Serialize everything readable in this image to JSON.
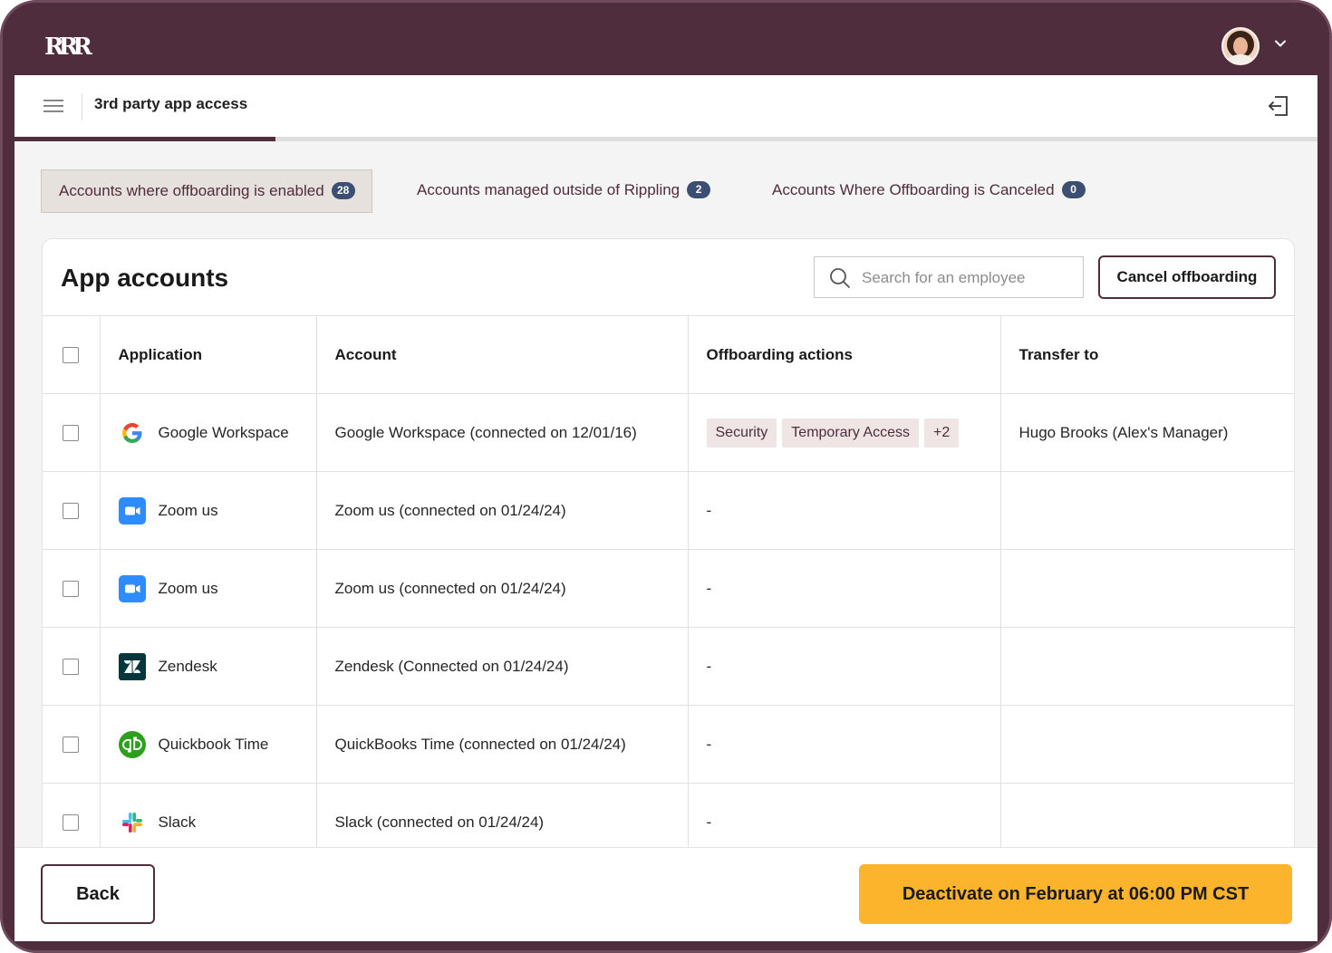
{
  "header": {
    "logo": "RRR"
  },
  "subheader": {
    "title": "3rd party app access",
    "progress_fraction": 0.2
  },
  "tabs": [
    {
      "label": "Accounts where offboarding is enabled",
      "count": "28",
      "active": true
    },
    {
      "label": "Accounts managed outside of Rippling",
      "count": "2",
      "active": false
    },
    {
      "label": "Accounts Where Offboarding is Canceled",
      "count": "0",
      "active": false
    }
  ],
  "card": {
    "title": "App accounts",
    "search": {
      "placeholder": "Search for an employee",
      "value": ""
    },
    "cancel_label": "Cancel offboarding"
  },
  "table": {
    "columns": [
      "Application",
      "Account",
      "Offboarding actions",
      "Transfer to"
    ],
    "rows": [
      {
        "icon": "google-icon",
        "app": "Google Workspace",
        "account": "Google Workspace (connected on 12/01/16)",
        "actions": "",
        "tags": [
          "Security",
          "Temporary Access",
          "+2"
        ],
        "transfer": "Hugo Brooks (Alex's Manager)"
      },
      {
        "icon": "zoom-icon",
        "app": "Zoom us",
        "account": "Zoom us (connected on 01/24/24)",
        "actions": "-",
        "tags": [],
        "transfer": ""
      },
      {
        "icon": "zoom-icon",
        "app": "Zoom us",
        "account": "Zoom us (connected on 01/24/24)",
        "actions": "-",
        "tags": [],
        "transfer": ""
      },
      {
        "icon": "zendesk-icon",
        "app": "Zendesk",
        "account": "Zendesk (Connected on 01/24/24)",
        "actions": "-",
        "tags": [],
        "transfer": ""
      },
      {
        "icon": "quickbooks-icon",
        "app": "Quickbook Time",
        "account": "QuickBooks Time (connected on 01/24/24)",
        "actions": "-",
        "tags": [],
        "transfer": ""
      },
      {
        "icon": "slack-icon",
        "app": "Slack",
        "account": "Slack (connected on 01/24/24)",
        "actions": "-",
        "tags": [],
        "transfer": ""
      }
    ]
  },
  "footer": {
    "back_label": "Back",
    "deactivate_label": "Deactivate on February at 06:00 PM CST"
  },
  "colors": {
    "brand": "#4f2d3c",
    "accent": "#fbb42c",
    "badge": "#3c4f73",
    "tag_bg": "#efe5e5"
  }
}
